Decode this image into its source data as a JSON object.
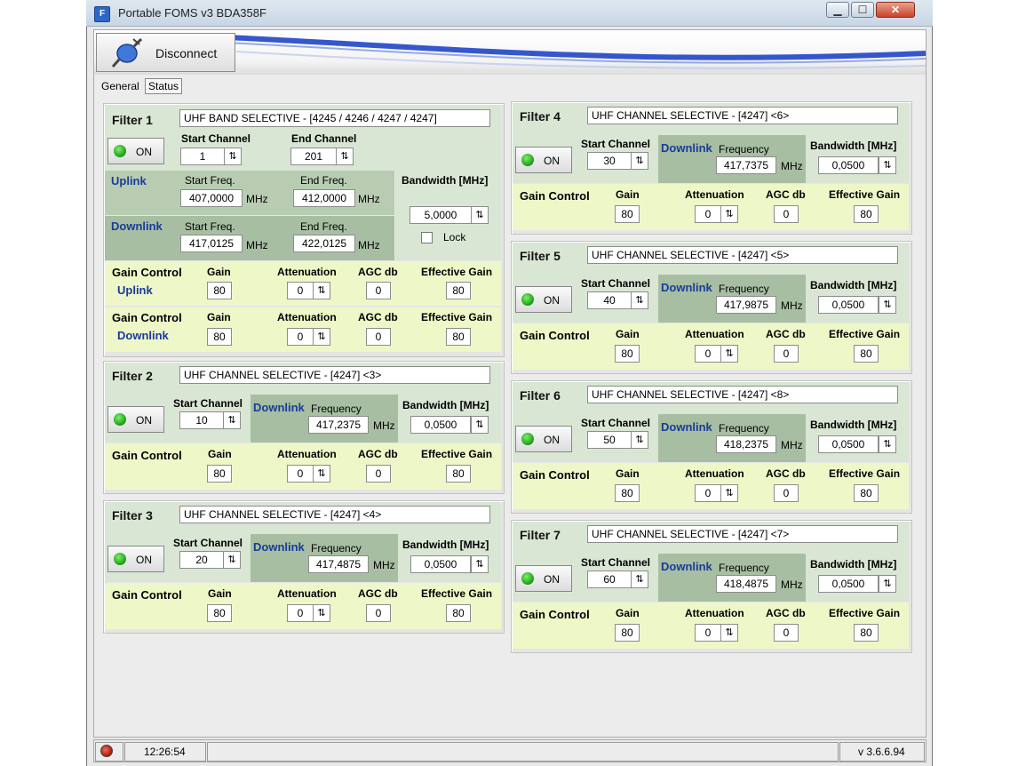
{
  "window": {
    "title": "Portable FOMS v3 BDA358F",
    "minimize_label": "▁",
    "maximize_label": "☐",
    "close_label": "✕"
  },
  "toolbar": {
    "disconnect_label": "Disconnect"
  },
  "tabs": [
    {
      "label": "General",
      "active": false
    },
    {
      "label": "Status",
      "active": true
    }
  ],
  "common": {
    "on_label": "ON",
    "start_channel": "Start Channel",
    "end_channel": "End Channel",
    "uplink": "Uplink",
    "downlink": "Downlink",
    "start_freq": "Start Freq.",
    "end_freq": "End Freq.",
    "frequency": "Frequency",
    "mhz": "MHz",
    "bandwidth": "Bandwidth [MHz]",
    "lock": "Lock",
    "gain_control": "Gain Control",
    "gain": "Gain",
    "attenuation": "Attenuation",
    "agc_db": "AGC db",
    "effective_gain": "Effective Gain"
  },
  "filter1": {
    "title": "Filter 1",
    "name": "UHF BAND SELECTIVE - [4245 / 4246 / 4247 / 4247]",
    "start_channel": "1",
    "end_channel": "201",
    "uplink_start_freq": "407,0000",
    "uplink_end_freq": "412,0000",
    "downlink_start_freq": "417,0125",
    "downlink_end_freq": "422,0125",
    "bandwidth": "5,0000",
    "lock_checked": false,
    "uplink_gain": {
      "gain": "80",
      "attenuation": "0",
      "agc": "0",
      "effective": "80"
    },
    "downlink_gain": {
      "gain": "80",
      "attenuation": "0",
      "agc": "0",
      "effective": "80"
    }
  },
  "channel_filters": [
    {
      "title": "Filter 2",
      "name": "UHF CHANNEL SELECTIVE - [4247] <3>",
      "start_channel": "10",
      "frequency": "417,2375",
      "bandwidth": "0,0500",
      "gain": "80",
      "attenuation": "0",
      "agc": "0",
      "effective": "80"
    },
    {
      "title": "Filter 3",
      "name": "UHF CHANNEL SELECTIVE - [4247] <4>",
      "start_channel": "20",
      "frequency": "417,4875",
      "bandwidth": "0,0500",
      "gain": "80",
      "attenuation": "0",
      "agc": "0",
      "effective": "80"
    },
    {
      "title": "Filter 4",
      "name": "UHF CHANNEL SELECTIVE - [4247] <6>",
      "start_channel": "30",
      "frequency": "417,7375",
      "bandwidth": "0,0500",
      "gain": "80",
      "attenuation": "0",
      "agc": "0",
      "effective": "80"
    },
    {
      "title": "Filter 5",
      "name": "UHF CHANNEL SELECTIVE - [4247] <5>",
      "start_channel": "40",
      "frequency": "417,9875",
      "bandwidth": "0,0500",
      "gain": "80",
      "attenuation": "0",
      "agc": "0",
      "effective": "80"
    },
    {
      "title": "Filter 6",
      "name": "UHF CHANNEL SELECTIVE - [4247] <8>",
      "start_channel": "50",
      "frequency": "418,2375",
      "bandwidth": "0,0500",
      "gain": "80",
      "attenuation": "0",
      "agc": "0",
      "effective": "80"
    },
    {
      "title": "Filter 7",
      "name": "UHF CHANNEL SELECTIVE - [4247] <7>",
      "start_channel": "60",
      "frequency": "418,4875",
      "bandwidth": "0,0500",
      "gain": "80",
      "attenuation": "0",
      "agc": "0",
      "effective": "80"
    }
  ],
  "statusbar": {
    "time": "12:26:54",
    "version": "v 3.6.6.94"
  },
  "icons": {
    "app": "app-icon",
    "disconnect": "plug-icon",
    "spin": "spin-arrows-icon",
    "led": "green-led-icon",
    "record": "record-icon"
  }
}
